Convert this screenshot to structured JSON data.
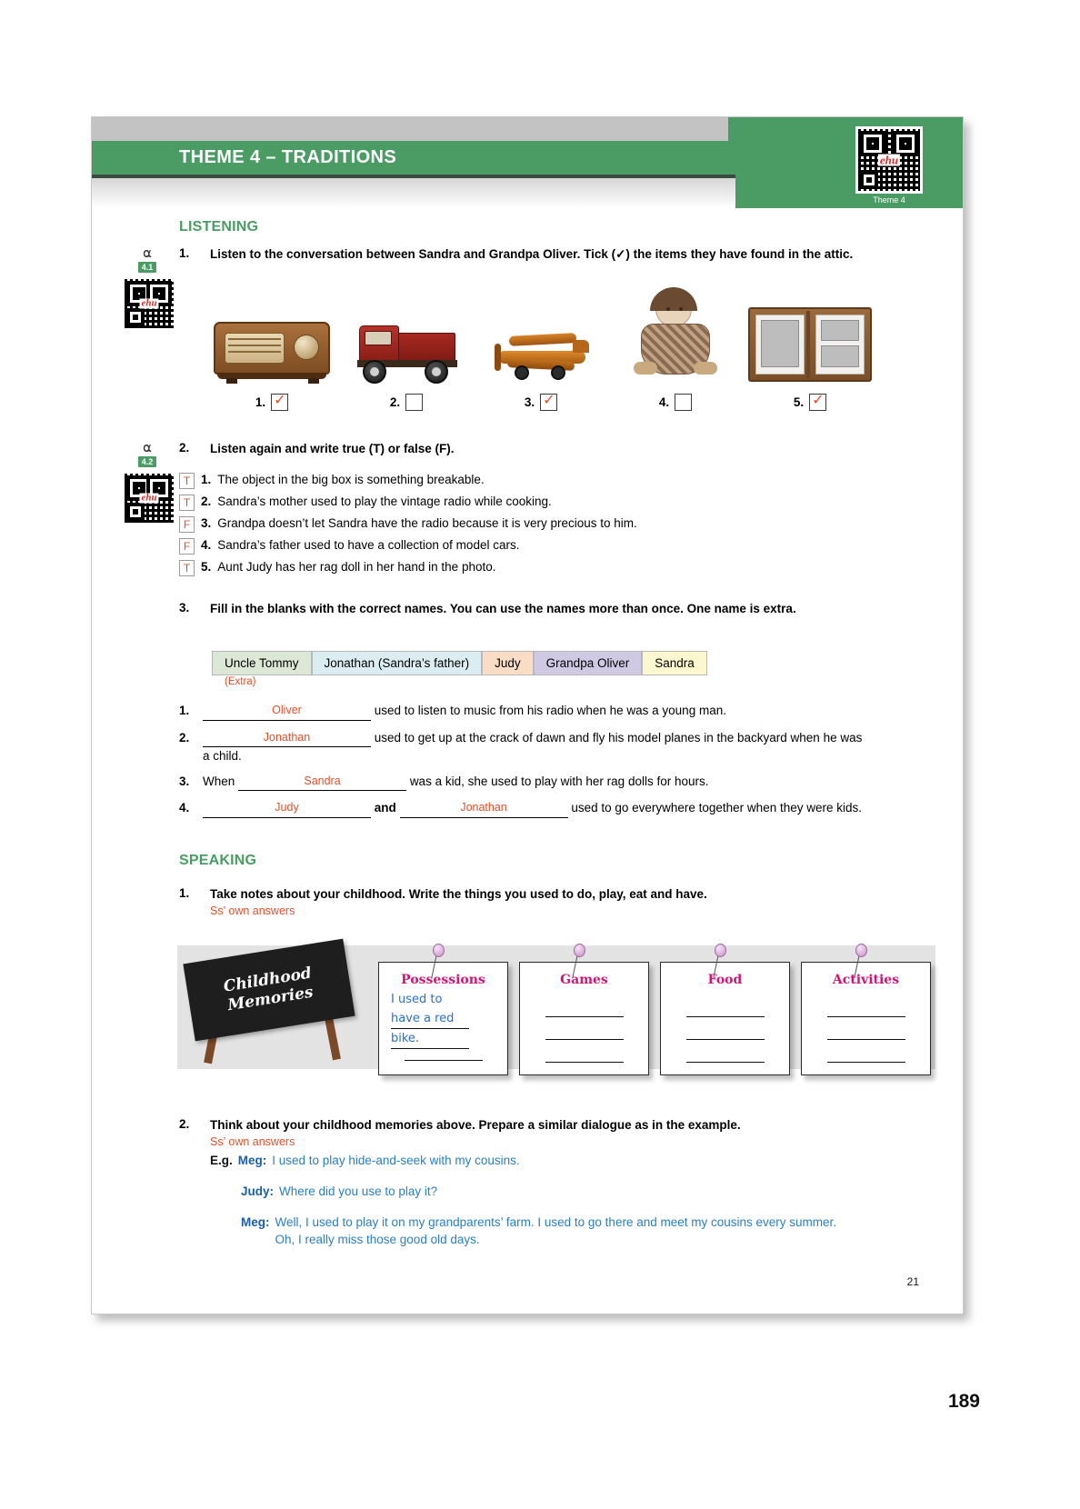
{
  "header": {
    "title": "THEME 4 – TRADITIONS",
    "qr_label": "Theme 4",
    "qr_brand": "ehu"
  },
  "listening": {
    "section_label": "LISTENING",
    "ex1": {
      "number": "1.",
      "track": "4.1",
      "instruction": "Listen to the conversation between Sandra and Grandpa Oliver. Tick (✓) the items they have found in the attic.",
      "items": [
        {
          "label": "1.",
          "name": "vintage-radio",
          "checked": true
        },
        {
          "label": "2.",
          "name": "model-truck",
          "checked": false
        },
        {
          "label": "3.",
          "name": "model-plane",
          "checked": true
        },
        {
          "label": "4.",
          "name": "rag-doll",
          "checked": false
        },
        {
          "label": "5.",
          "name": "photo-album",
          "checked": true
        }
      ]
    },
    "ex2": {
      "number": "2.",
      "track": "4.2",
      "instruction": "Listen again and write true (T) or false (F).",
      "statements": [
        {
          "answer": "T",
          "number": "1.",
          "text": "The object in the big box is something breakable."
        },
        {
          "answer": "T",
          "number": "2.",
          "text": "Sandra’s mother used to play the vintage radio while cooking."
        },
        {
          "answer": "F",
          "number": "3.",
          "text": "Grandpa doesn’t let Sandra have the radio because it is very precious to him."
        },
        {
          "answer": "F",
          "number": "4.",
          "text": "Sandra’s father used to have a collection of model cars."
        },
        {
          "answer": "T",
          "number": "5.",
          "text": "Aunt Judy has her rag doll in her hand in the photo."
        }
      ]
    },
    "ex3": {
      "number": "3.",
      "instruction": "Fill in the blanks with the correct names. You can use the names more than once. One name is extra.",
      "names": [
        {
          "label": "Uncle Tommy",
          "color": "#dde7d5"
        },
        {
          "label": "Jonathan (Sandra’s father)",
          "color": "#dcedf2"
        },
        {
          "label": "Judy",
          "color": "#fbdcc4"
        },
        {
          "label": "Grandpa Oliver",
          "color": "#cfc9e4"
        },
        {
          "label": "Sandra",
          "color": "#fbf8cf"
        }
      ],
      "extra_note": "(Extra)",
      "blanks": [
        {
          "number": "1.",
          "pre": "",
          "answer": "Oliver",
          "mid": "",
          "answer2": "",
          "post": "used to listen to music from his radio when he was a young man."
        },
        {
          "number": "2.",
          "pre": "",
          "answer": "Jonathan",
          "mid": "",
          "answer2": "",
          "post": "used to get up at the crack of dawn and fly his model planes in the backyard when he was a child."
        },
        {
          "number": "3.",
          "pre": "When",
          "answer": "Sandra",
          "mid": "",
          "answer2": "",
          "post": "was a kid, she used to play with her rag dolls for hours."
        },
        {
          "number": "4.",
          "pre": "",
          "answer": "Judy",
          "mid": "and",
          "answer2": "Jonathan",
          "post": "used to go everywhere together when they were kids."
        }
      ]
    }
  },
  "speaking": {
    "section_label": "SPEAKING",
    "ex1": {
      "number": "1.",
      "instruction": "Take notes about your childhood. Write the things you used to do, play, eat and have.",
      "answer_note": "Ss’ own answers",
      "sign_line1": "Childhood",
      "sign_line2": "Memories",
      "cards": [
        {
          "title": "Possessions",
          "handwriting": [
            "I used to",
            "have a red",
            "bike."
          ],
          "blank_lines": 1
        },
        {
          "title": "Games",
          "handwriting": [],
          "blank_lines": 3
        },
        {
          "title": "Food",
          "handwriting": [],
          "blank_lines": 3
        },
        {
          "title": "Activities",
          "handwriting": [],
          "blank_lines": 3
        }
      ]
    },
    "ex2": {
      "number": "2.",
      "instruction": "Think about your childhood memories above. Prepare a similar dialogue as in the example.",
      "answer_note": "Ss’ own answers",
      "eg_label": "E.g.",
      "lines": [
        {
          "speaker": "Meg:",
          "text": "I used to play hide-and-seek with my cousins."
        },
        {
          "speaker": "Judy:",
          "text": "Where did you use to play it?"
        },
        {
          "speaker": "Meg:",
          "text": "Well, I used to play it on my grandparents’ farm. I used to go there and meet my cousins every summer. Oh, I really miss those good old days."
        }
      ]
    }
  },
  "footer": {
    "inner_page": "21",
    "outer_page": "189"
  },
  "colors": {
    "green": "#4a9c64",
    "red": "#e0502a",
    "blue": "#2a7fc0",
    "pink": "#cf1578"
  }
}
